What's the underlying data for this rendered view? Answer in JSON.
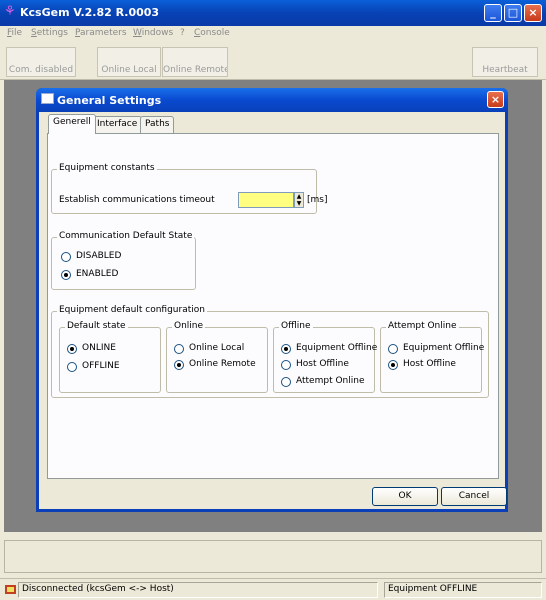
{
  "window": {
    "title": "KcsGem V.2.82 R.0003",
    "minimize": "_",
    "maximize": "□",
    "close": "×"
  },
  "menu": [
    "File",
    "Settings",
    "Parameters",
    "Windows",
    "?",
    "Console"
  ],
  "toolbar": {
    "com_disabled": "Com. disabled",
    "online_local": "Online Local",
    "online_remote": "Online Remote",
    "heartbeat": "Heartbeat"
  },
  "dialog": {
    "title": "General Settings",
    "close": "×",
    "tabs": [
      "Generell",
      "Interface",
      "Paths"
    ],
    "active_tab": "Generell",
    "equipment_constants": {
      "legend": "Equipment constants",
      "timeout_label": "Establish communications timeout",
      "timeout_value": "",
      "unit": "[ms]"
    },
    "comm_default_state": {
      "legend": "Communication Default State",
      "options": [
        "DISABLED",
        "ENABLED"
      ],
      "selected": "ENABLED"
    },
    "equipment_default_config": {
      "legend": "Equipment default configuration",
      "default_state": {
        "legend": "Default state",
        "options": [
          "ONLINE",
          "OFFLINE"
        ],
        "selected": "ONLINE"
      },
      "online": {
        "legend": "Online",
        "options": [
          "Online Local",
          "Online Remote"
        ],
        "selected": "Online Remote"
      },
      "offline": {
        "legend": "Offline",
        "options": [
          "Equipment Offline",
          "Host Offline",
          "Attempt Online"
        ],
        "selected": "Equipment Offline"
      },
      "attempt_online": {
        "legend": "Attempt Online",
        "options": [
          "Equipment Offline",
          "Host Offline"
        ],
        "selected": "Host Offline"
      }
    },
    "ok": "OK",
    "cancel": "Cancel"
  },
  "status": {
    "connection": "Disconnected (kcsGem <-> Host)",
    "equipment": "Equipment OFFLINE"
  },
  "colors": {
    "titlebar": "#0842b5",
    "workspace": "#808080",
    "input_highlight": "#ffff80"
  }
}
